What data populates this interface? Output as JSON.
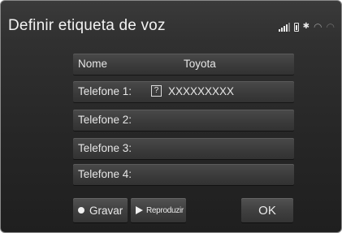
{
  "header": {
    "title": "Definir etiqueta de voz"
  },
  "status_icons": [
    "signal-icon",
    "battery-icon",
    "bluetooth-icon",
    "wifi-icon",
    "wifi-weak-icon"
  ],
  "fields": [
    {
      "label": "Nome",
      "value": "Toyota"
    },
    {
      "label": "Telefone 1:",
      "value": "XXXXXXXXX",
      "icon": "?"
    },
    {
      "label": "Telefone 2:",
      "value": ""
    },
    {
      "label": "Telefone 3:",
      "value": ""
    },
    {
      "label": "Telefone 4:",
      "value": ""
    }
  ],
  "buttons": {
    "record": "Gravar",
    "play": "Reproduzir",
    "ok": "OK"
  }
}
